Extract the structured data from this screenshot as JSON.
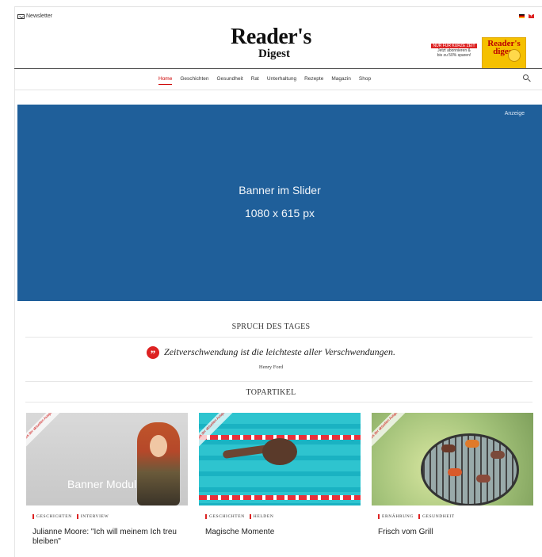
{
  "header": {
    "newsletter_label": "Newsletter",
    "logo_line1": "Reader's",
    "logo_line2": "Digest",
    "promo": {
      "badge": "NUR FÜR KURZE ZEIT",
      "line1": "Jetzt abonnieren &",
      "line2": "bis zu 50% sparen!",
      "cover_title": "Reader's digest"
    }
  },
  "nav": {
    "items": [
      "Home",
      "Geschichten",
      "Gesundheit",
      "Rat",
      "Unterhaltung",
      "Rezepte",
      "Magazin",
      "Shop"
    ],
    "active": "Home"
  },
  "banner": {
    "ad_label": "Anzeige",
    "line1": "Banner im Slider",
    "line2": "1080 x 615 px"
  },
  "quote_section": {
    "title": "SPRUCH DES TAGES",
    "text": "Zeitverschwendung ist die leichteste aller Verschwendungen.",
    "author": "Henry Ford"
  },
  "top_section": {
    "title": "TOPARTIKEL",
    "cards": [
      {
        "ribbon": "Aus der aktuellen Ausgabe",
        "image_label": "Banner Modul",
        "tags": [
          "GESCHICHTEN",
          "INTERVIEW"
        ],
        "title": "Julianne Moore: \"Ich will meinem Ich treu bleiben\""
      },
      {
        "ribbon": "Aus der aktuellen Ausgabe",
        "tags": [
          "GESCHICHTEN",
          "HELDEN"
        ],
        "title": "Magische Momente"
      },
      {
        "ribbon": "Aus der aktuellen Ausgabe",
        "tags": [
          "ERNÄHRUNG",
          "GESUNDHEIT"
        ],
        "title": "Frisch vom Grill"
      }
    ]
  },
  "colors": {
    "accent_red": "#d22222",
    "banner_blue": "#1f5f9a"
  }
}
